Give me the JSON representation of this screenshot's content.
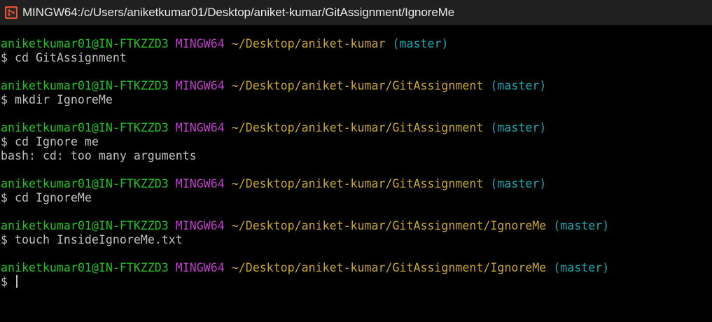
{
  "window": {
    "title": "MINGW64:/c/Users/aniketkumar01/Desktop/aniket-kumar/GitAssignment/IgnoreMe",
    "icon": "git-bash-icon"
  },
  "colors": {
    "user": "#23c323",
    "system": "#c13fcd",
    "path": "#c8a632",
    "branch": "#19a8b4",
    "text": "#c0c0c0",
    "background": "#000000"
  },
  "terminal": {
    "prompt_symbol": "$",
    "blocks": [
      {
        "user_host": "aniketkumar01@IN-FTKZZD3",
        "system": "MINGW64",
        "path": "~/Desktop/aniket-kumar",
        "branch": "(master)",
        "command": "cd GitAssignment",
        "output": []
      },
      {
        "user_host": "aniketkumar01@IN-FTKZZD3",
        "system": "MINGW64",
        "path": "~/Desktop/aniket-kumar/GitAssignment",
        "branch": "(master)",
        "command": "mkdir IgnoreMe",
        "output": []
      },
      {
        "user_host": "aniketkumar01@IN-FTKZZD3",
        "system": "MINGW64",
        "path": "~/Desktop/aniket-kumar/GitAssignment",
        "branch": "(master)",
        "command": "cd Ignore me",
        "output": [
          "bash: cd: too many arguments"
        ]
      },
      {
        "user_host": "aniketkumar01@IN-FTKZZD3",
        "system": "MINGW64",
        "path": "~/Desktop/aniket-kumar/GitAssignment",
        "branch": "(master)",
        "command": "cd IgnoreMe",
        "output": []
      },
      {
        "user_host": "aniketkumar01@IN-FTKZZD3",
        "system": "MINGW64",
        "path": "~/Desktop/aniket-kumar/GitAssignment/IgnoreMe",
        "branch": "(master)",
        "command": "touch InsideIgnoreMe.txt",
        "output": []
      },
      {
        "user_host": "aniketkumar01@IN-FTKZZD3",
        "system": "MINGW64",
        "path": "~/Desktop/aniket-kumar/GitAssignment/IgnoreMe",
        "branch": "(master)",
        "command": "",
        "output": [],
        "active": true
      }
    ]
  }
}
